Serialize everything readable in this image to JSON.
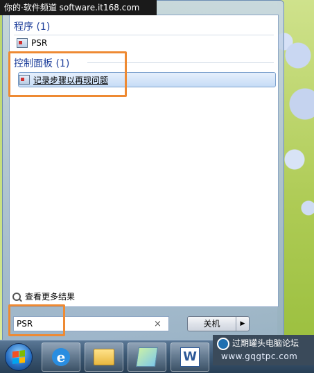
{
  "watermark": {
    "text": "你的·软件频道 software.it168.com"
  },
  "search_results": {
    "groups": [
      {
        "header": "程序 (1)",
        "items": [
          {
            "label": "PSR",
            "icon": "psr-icon"
          }
        ]
      },
      {
        "header": "控制面板 (1)",
        "items": [
          {
            "label": "记录步骤以再现问题",
            "icon": "control-panel-icon",
            "selected": true
          }
        ]
      }
    ],
    "see_more": "查看更多结果"
  },
  "search_box": {
    "value": "PSR",
    "clear_symbol": "×"
  },
  "shutdown": {
    "label": "关机",
    "arrow": "▶"
  },
  "taskbar": {
    "apps": [
      "start-orb",
      "ie-icon",
      "explorer-icon",
      "sticky-notes-icon",
      "word-icon"
    ],
    "ie_glyph": "e",
    "word_glyph": "W"
  },
  "forum_badge": {
    "name": "过期罐头电脑论坛",
    "url": "www.gqgtpc.com"
  },
  "colors": {
    "highlight": "#ee8a33",
    "group_header": "#1e3f9b",
    "selection": "#c6dcf6"
  }
}
